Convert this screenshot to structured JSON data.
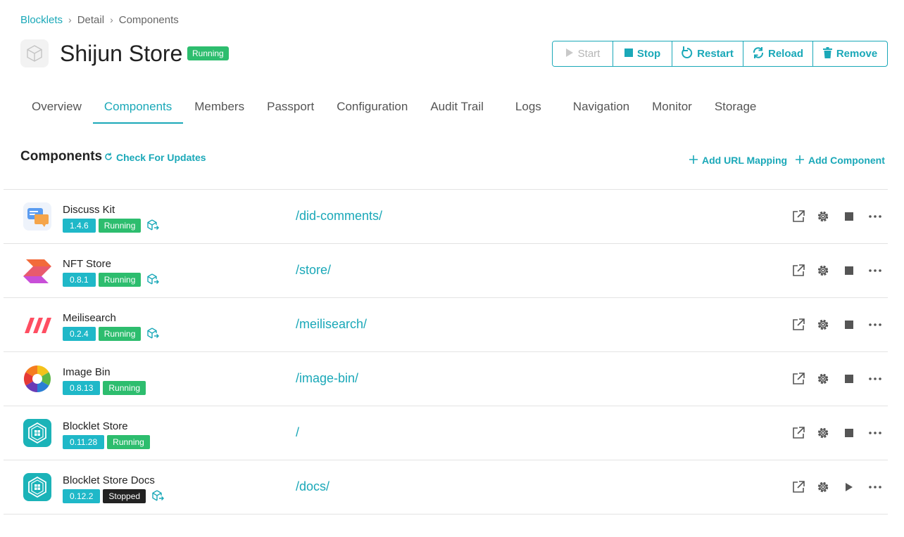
{
  "breadcrumb": {
    "root": "Blocklets",
    "middle": "Detail",
    "current": "Components"
  },
  "app": {
    "title": "Shijun Store",
    "status": "Running"
  },
  "actions": {
    "start": "Start",
    "stop": "Stop",
    "restart": "Restart",
    "reload": "Reload",
    "remove": "Remove"
  },
  "tabs": [
    "Overview",
    "Components",
    "Members",
    "Passport",
    "Configuration",
    "Audit Trail",
    "Logs",
    "Navigation",
    "Monitor",
    "Storage"
  ],
  "active_tab": "Components",
  "section": {
    "title": "Components",
    "check_updates": "Check For Updates",
    "add_url_mapping": "Add URL Mapping",
    "add_component": "Add Component"
  },
  "components": [
    {
      "name": "Discuss Kit",
      "version": "1.4.6",
      "status": "Running",
      "path": "/did-comments/",
      "logo": "discuss-kit-logo"
    },
    {
      "name": "NFT Store",
      "version": "0.8.1",
      "status": "Running",
      "path": "/store/",
      "logo": "nft-store-logo"
    },
    {
      "name": "Meilisearch",
      "version": "0.2.4",
      "status": "Running",
      "path": "/meilisearch/",
      "logo": "meilisearch-logo"
    },
    {
      "name": "Image Bin",
      "version": "0.8.13",
      "status": "Running",
      "path": "/image-bin/",
      "logo": "image-bin-logo"
    },
    {
      "name": "Blocklet Store",
      "version": "0.11.28",
      "status": "Running",
      "path": "/",
      "logo": "blocklet-store-logo"
    },
    {
      "name": "Blocklet Store Docs",
      "version": "0.12.2",
      "status": "Stopped",
      "path": "/docs/",
      "logo": "blocklet-store-docs-logo"
    }
  ],
  "colors": {
    "accent": "#1aa8b8",
    "running": "#2dbd6e",
    "stopped": "#222222",
    "version": "#1fb8c8"
  }
}
